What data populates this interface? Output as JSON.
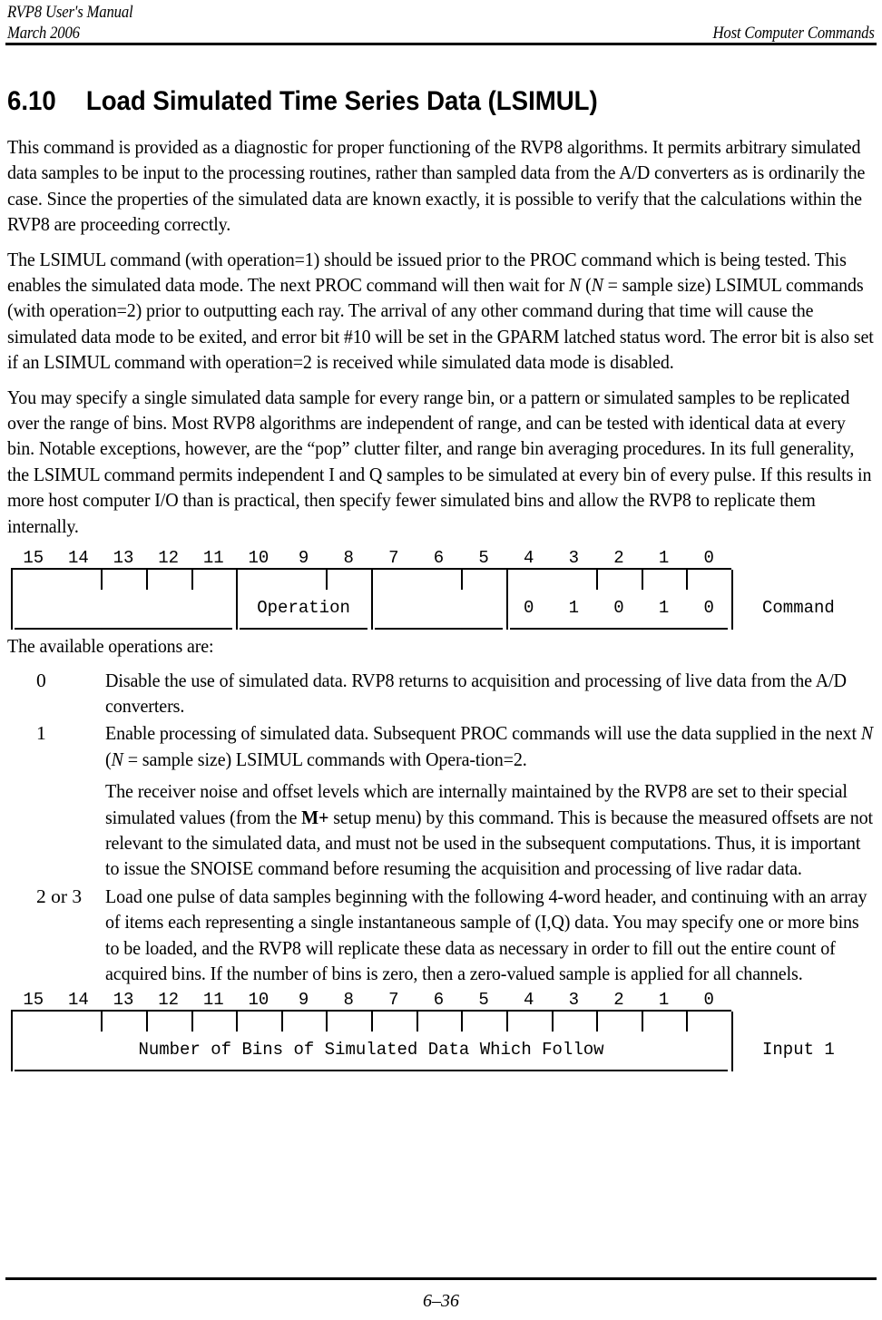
{
  "header": {
    "manual_title": "RVP8 User's Manual",
    "date": "March 2006",
    "chapter": "Host Computer Commands"
  },
  "section": {
    "number": "6.10",
    "title": "Load Simulated Time Series Data (LSIMUL)"
  },
  "paragraphs": {
    "p1": "This command is provided as a diagnostic for proper functioning of the RVP8 algorithms.  It permits arbitrary simulated data samples to be input to the processing routines, rather than sampled data from the A/D converters as is ordinarily the case.  Since the properties of the simulated data are known exactly, it is possible to verify that the calculations within the RVP8 are proceeding correctly.",
    "p2_a": "The LSIMUL command (with operation=1) should be issued prior to the PROC command which is being tested.  This enables the simulated data mode.  The next PROC command will then wait for ",
    "p2_n1": "N",
    "p2_b": " (",
    "p2_n2": "N",
    "p2_c": " = sample size) LSIMUL commands (with operation=2) prior to outputting each ray. The arrival of any other command during that time will cause the simulated data mode to be exited, and error bit #10 will be set in the GPARM latched status word.  The error bit is also set if an LSIMUL command with operation=2 is received while simulated data mode is disabled.",
    "p3": "You may specify a single simulated data sample for every range bin, or a pattern or simulated samples to be replicated over the range of bins.  Most RVP8 algorithms are independent of range, and can be tested with identical data at every bin.  Notable exceptions, however, are the “pop” clutter filter, and range bin averaging procedures.  In its full generality, the LSIMUL command permits independent I and Q samples to be simulated at every bin of every pulse.  If this results in more host computer I/O than is practical, then specify fewer simulated bins and allow the RVP8 to replicate them internally.",
    "p4": "The available operations are:"
  },
  "command_word": {
    "bit_labels": [
      "15",
      "14",
      "13",
      "12",
      "11",
      "10",
      "9",
      "8",
      "7",
      "6",
      "5",
      "4",
      "3",
      "2",
      "1",
      "0"
    ],
    "fields": [
      {
        "name": "",
        "from": 15,
        "to": 11
      },
      {
        "name": "Operation",
        "from": 10,
        "to": 8
      },
      {
        "name": "",
        "from": 7,
        "to": 5
      },
      {
        "name": "",
        "from": 4,
        "to": 0
      }
    ],
    "bit_values": [
      {
        "bit": 4,
        "value": "0"
      },
      {
        "bit": 3,
        "value": "1"
      },
      {
        "bit": 2,
        "value": "0"
      },
      {
        "bit": 1,
        "value": "1"
      },
      {
        "bit": 0,
        "value": "0"
      }
    ],
    "row_label": "Command"
  },
  "input_word": {
    "bit_labels": [
      "15",
      "14",
      "13",
      "12",
      "11",
      "10",
      "9",
      "8",
      "7",
      "6",
      "5",
      "4",
      "3",
      "2",
      "1",
      "0"
    ],
    "fields": [
      {
        "name": "Number of Bins of Simulated Data Which Follow",
        "from": 15,
        "to": 0
      }
    ],
    "bit_values": [],
    "row_label": "Input 1"
  },
  "operations": [
    {
      "key": "0",
      "paras": [
        "Disable the use of simulated data.  RVP8 returns to acquisition and processing of live data from the A/D converters."
      ]
    },
    {
      "key": "1",
      "paras": [
        "Enable processing of simulated data.  Subsequent PROC commands will use the data supplied in the next N (N = sample size) LSIMUL commands with Opera-tion=2.",
        "The receiver noise and offset levels which are internally maintained by the RVP8 are set to their special simulated values (from the M+ setup menu) by this command.  This is because the measured offsets are not relevant to the simulated data, and must not be used in the subsequent computations.  Thus, it is important to issue the SNOISE command before resuming the acquisition and processing of live radar data."
      ]
    },
    {
      "key": "2 or 3",
      "paras": [
        "Load one pulse of data samples beginning with the following 4-word header, and continuing with an array of items each representing a single instantaneous sample of (I,Q) data.  You may specify one or more bins to be loaded, and the RVP8 will replicate these data as necessary in order to fill out the entire count of acquired bins.  If the number of bins is zero, then a zero-valued sample is applied for all channels."
      ]
    }
  ],
  "op1_rich": {
    "a": "Enable processing of simulated data.  Subsequent PROC commands will use the data supplied in the next ",
    "n1": "N",
    "b": " (",
    "n2": "N",
    "c": " = sample size) LSIMUL commands with Opera-tion=2."
  },
  "op1b_rich": {
    "a": "The receiver noise and offset levels which are internally maintained by the RVP8 are set to their special simulated values (from the ",
    "bold": "M+",
    "b": " setup menu) by this command.  This is because the measured offsets are not relevant to the simulated data, and must not be used in the subsequent computations.  Thus, it is important to issue the SNOISE command before resuming the acquisition and processing of live radar data."
  },
  "footer": {
    "page": "6–36"
  }
}
